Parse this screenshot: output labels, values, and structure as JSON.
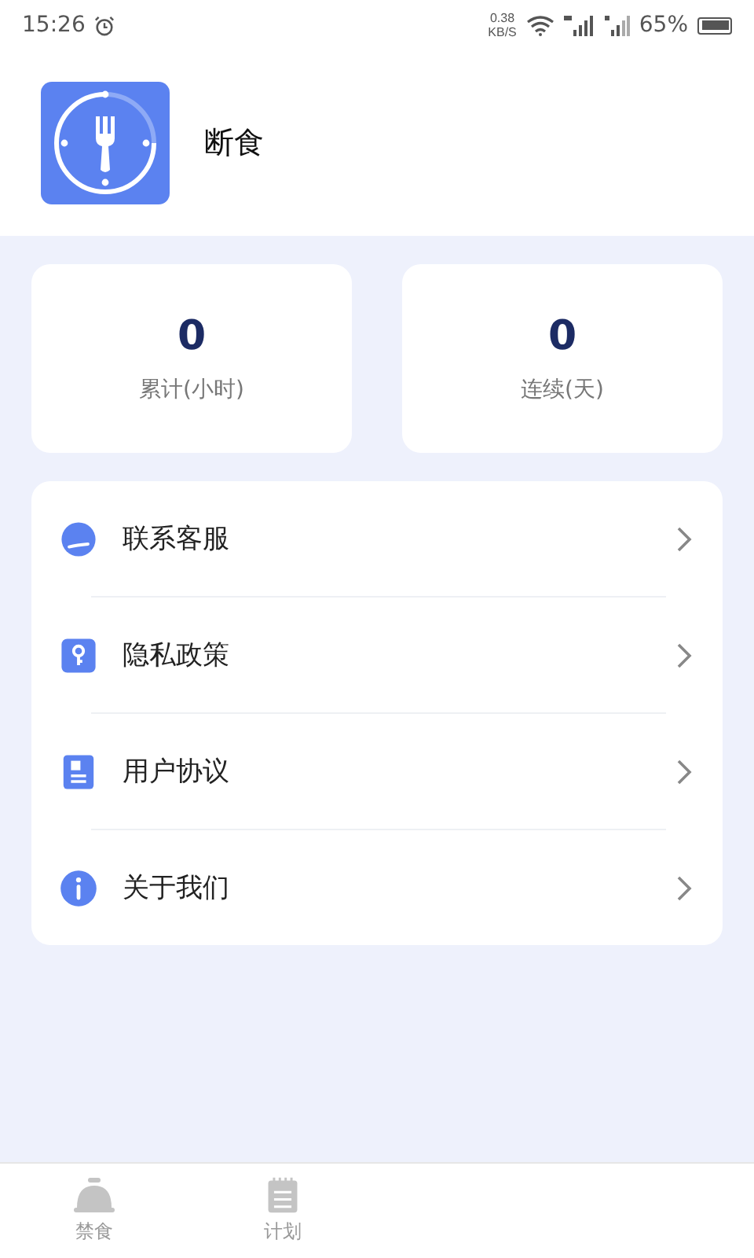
{
  "status_bar": {
    "time": "15:26",
    "net_speed": "0.38",
    "net_unit": "KB/S",
    "battery": "65%"
  },
  "header": {
    "title": "断食"
  },
  "stats": [
    {
      "value": "0",
      "label": "累计(小时)"
    },
    {
      "value": "0",
      "label": "连续(天)"
    }
  ],
  "menu": [
    {
      "kind": "service",
      "label": "联系客服"
    },
    {
      "kind": "privacy",
      "label": "隐私政策"
    },
    {
      "kind": "agreement",
      "label": "用户协议"
    },
    {
      "kind": "about",
      "label": "关于我们"
    }
  ],
  "tabs": [
    {
      "kind": "fast",
      "label": "禁食",
      "selected": false
    },
    {
      "kind": "plan",
      "label": "计划",
      "selected": false
    }
  ]
}
